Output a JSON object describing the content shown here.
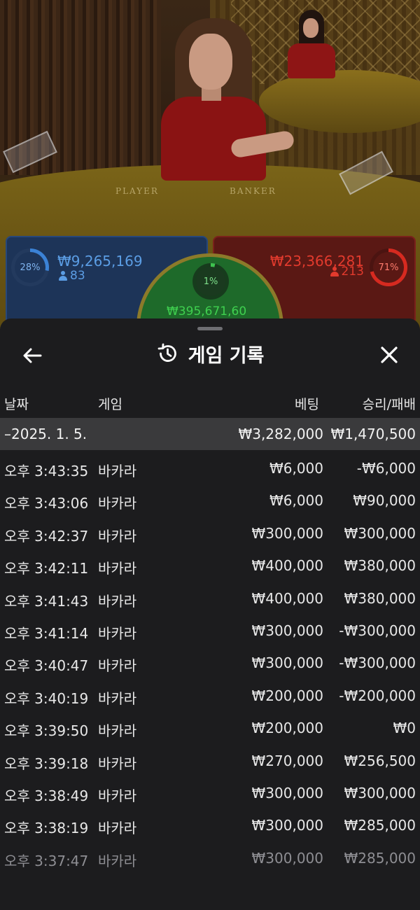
{
  "video": {
    "felt_labels": {
      "player": "PLAYER",
      "banker": "BANKER"
    }
  },
  "bets": {
    "player": {
      "percent": "28%",
      "amount": "₩9,265,169",
      "count": "83",
      "fill": 0.28,
      "color": "#3b82d6"
    },
    "banker": {
      "percent": "71%",
      "amount": "₩23,366,281",
      "count": "213",
      "fill": 0.71,
      "color": "#d62a20"
    },
    "tie": {
      "percent": "1%",
      "amount": "₩395,671,60",
      "fill": 0.01,
      "color": "#3ec34f"
    }
  },
  "history": {
    "title": "게임 기록",
    "icons": {
      "back": "arrow-left-icon",
      "title": "history-clock-icon",
      "close": "close-x-icon"
    },
    "columns": {
      "date": "날짜",
      "game": "게임",
      "bet": "베팅",
      "result": "승리/패배"
    },
    "date_group": {
      "date": "–2025. 1. 5.",
      "bet_total": "₩3,282,000",
      "result_total": "₩1,470,500"
    },
    "rows": [
      {
        "time": "오후 3:43:35",
        "game": "바카라",
        "bet": "₩6,000",
        "result": "-₩6,000"
      },
      {
        "time": "오후 3:43:06",
        "game": "바카라",
        "bet": "₩6,000",
        "result": "₩90,000"
      },
      {
        "time": "오후 3:42:37",
        "game": "바카라",
        "bet": "₩300,000",
        "result": "₩300,000"
      },
      {
        "time": "오후 3:42:11",
        "game": "바카라",
        "bet": "₩400,000",
        "result": "₩380,000"
      },
      {
        "time": "오후 3:41:43",
        "game": "바카라",
        "bet": "₩400,000",
        "result": "₩380,000"
      },
      {
        "time": "오후 3:41:14",
        "game": "바카라",
        "bet": "₩300,000",
        "result": "-₩300,000"
      },
      {
        "time": "오후 3:40:47",
        "game": "바카라",
        "bet": "₩300,000",
        "result": "-₩300,000"
      },
      {
        "time": "오후 3:40:19",
        "game": "바카라",
        "bet": "₩200,000",
        "result": "-₩200,000"
      },
      {
        "time": "오후 3:39:50",
        "game": "바카라",
        "bet": "₩200,000",
        "result": "₩0"
      },
      {
        "time": "오후 3:39:18",
        "game": "바카라",
        "bet": "₩270,000",
        "result": "₩256,500"
      },
      {
        "time": "오후 3:38:49",
        "game": "바카라",
        "bet": "₩300,000",
        "result": "₩300,000"
      },
      {
        "time": "오후 3:38:19",
        "game": "바카라",
        "bet": "₩300,000",
        "result": "₩285,000"
      },
      {
        "time": "오후 3:37:47",
        "game": "바카라",
        "bet": "₩300,000",
        "result": "₩285,000"
      }
    ]
  }
}
